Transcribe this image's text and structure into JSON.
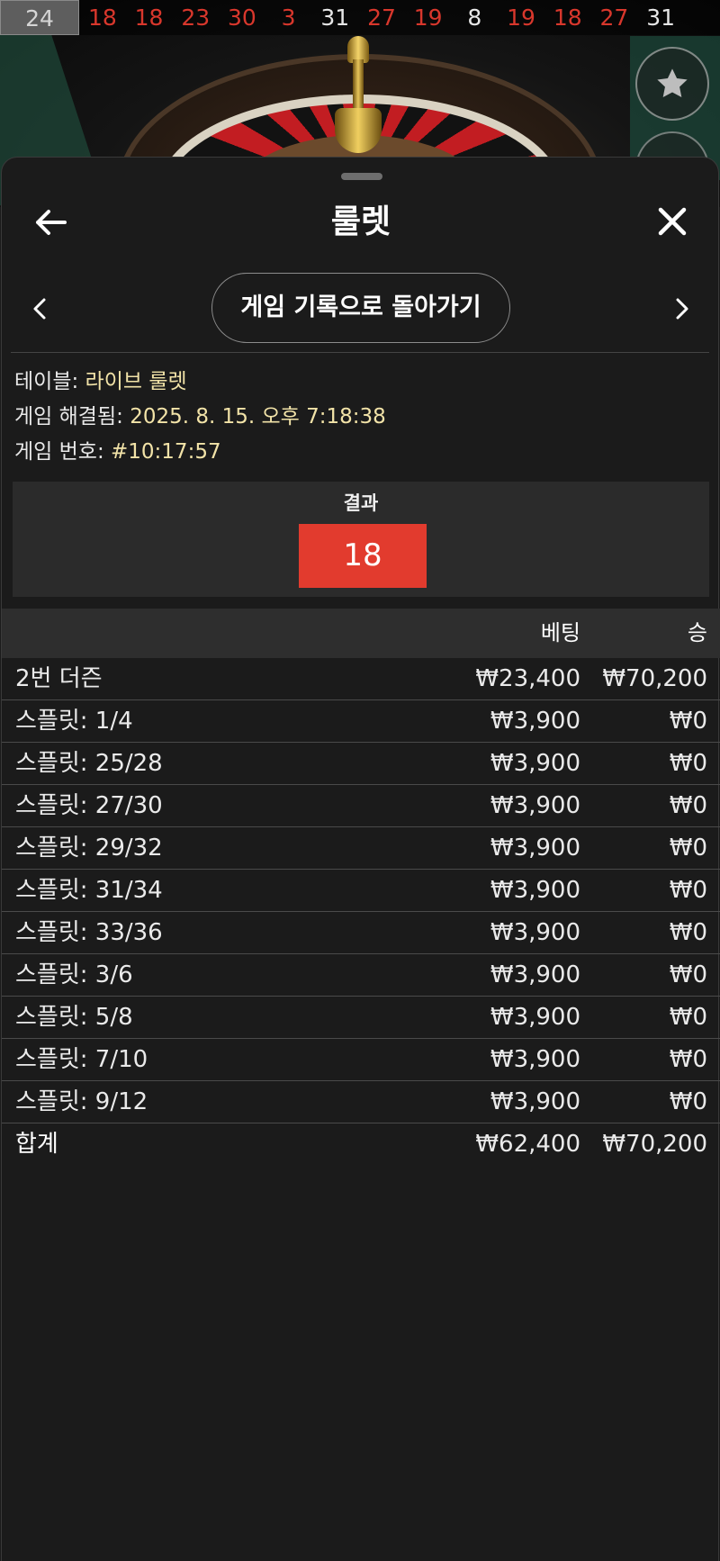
{
  "history": [
    {
      "n": "24",
      "color": "gray"
    },
    {
      "n": "18",
      "color": "red"
    },
    {
      "n": "18",
      "color": "red"
    },
    {
      "n": "23",
      "color": "red"
    },
    {
      "n": "30",
      "color": "red"
    },
    {
      "n": "3",
      "color": "red"
    },
    {
      "n": "31",
      "color": "black"
    },
    {
      "n": "27",
      "color": "red"
    },
    {
      "n": "19",
      "color": "red"
    },
    {
      "n": "8",
      "color": "black"
    },
    {
      "n": "19",
      "color": "red"
    },
    {
      "n": "18",
      "color": "red"
    },
    {
      "n": "27",
      "color": "red"
    },
    {
      "n": "31",
      "color": "black"
    }
  ],
  "header": {
    "title": "룰렛",
    "back_icon": "arrow-left-icon",
    "close_icon": "close-icon"
  },
  "nav": {
    "back_to_history": "게임 기록으로 돌아가기",
    "prev_icon": "chevron-left-icon",
    "next_icon": "chevron-right-icon"
  },
  "info": {
    "table_label": "테이블:",
    "table_value": "라이브 룰렛",
    "resolved_label": "게임 해결됨:",
    "resolved_value": "2025. 8. 15. 오후 7:18:38",
    "number_label": "게임 번호:",
    "number_value": "#10:17:57"
  },
  "result": {
    "label": "결과",
    "number": "18",
    "color": "#e23b2e"
  },
  "table": {
    "col_bet": "베팅",
    "col_win": "승",
    "rows": [
      {
        "name": "2번 더즌",
        "bet": "₩23,400",
        "win": "₩70,200"
      },
      {
        "name": "스플릿: 1/4",
        "bet": "₩3,900",
        "win": "₩0"
      },
      {
        "name": "스플릿: 25/28",
        "bet": "₩3,900",
        "win": "₩0"
      },
      {
        "name": "스플릿: 27/30",
        "bet": "₩3,900",
        "win": "₩0"
      },
      {
        "name": "스플릿: 29/32",
        "bet": "₩3,900",
        "win": "₩0"
      },
      {
        "name": "스플릿: 31/34",
        "bet": "₩3,900",
        "win": "₩0"
      },
      {
        "name": "스플릿: 33/36",
        "bet": "₩3,900",
        "win": "₩0"
      },
      {
        "name": "스플릿: 3/6",
        "bet": "₩3,900",
        "win": "₩0"
      },
      {
        "name": "스플릿: 5/8",
        "bet": "₩3,900",
        "win": "₩0"
      },
      {
        "name": "스플릿: 7/10",
        "bet": "₩3,900",
        "win": "₩0"
      },
      {
        "name": "스플릿: 9/12",
        "bet": "₩3,900",
        "win": "₩0"
      }
    ],
    "total": {
      "name": "합계",
      "bet": "₩62,400",
      "win": "₩70,200"
    }
  }
}
